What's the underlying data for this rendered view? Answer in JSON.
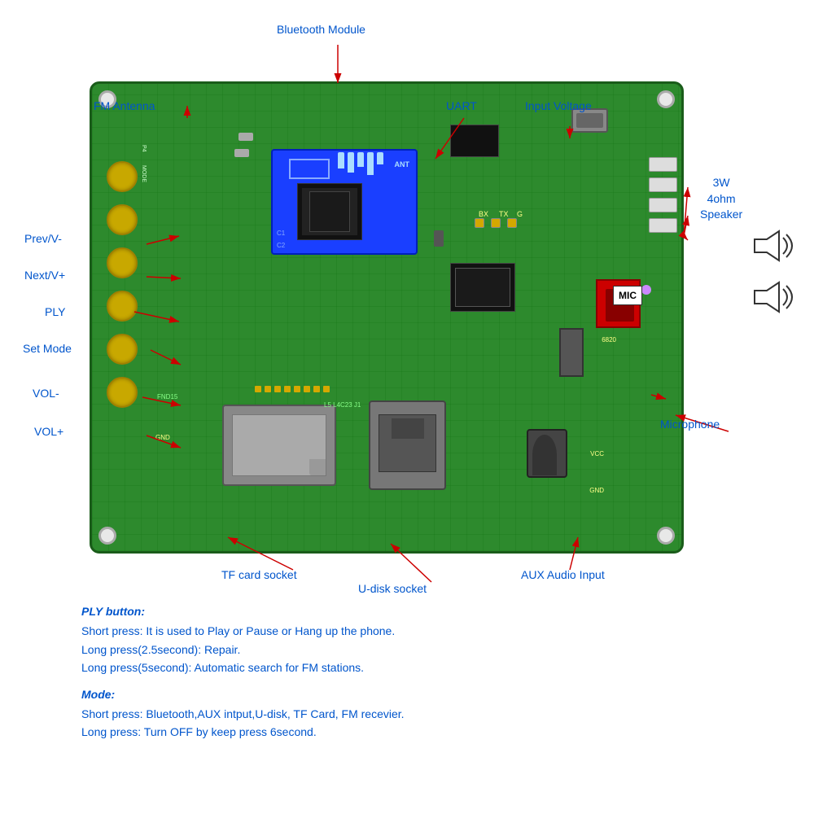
{
  "page": {
    "bg_color": "#ffffff",
    "accent_color": "#0055cc"
  },
  "labels": {
    "bluetooth_module": "Bluetooth Module",
    "fm_antenna": "FM Antenna",
    "uart": "UART",
    "input_voltage": "Input Voltage",
    "speaker": "3W\n4ohm\nSpeaker",
    "speaker_line1": "3W",
    "speaker_line2": "4ohm",
    "speaker_line3": "Speaker",
    "prev_v_minus": "Prev/V-",
    "next_v_plus": "Next/V+",
    "ply": "PLY",
    "set_mode": "Set Mode",
    "vol_minus": "VOL-",
    "vol_plus": "VOL+",
    "tf_card": "TF card socket",
    "u_disk": "U-disk socket",
    "aux_audio": "AUX Audio Input",
    "mic": "MIC",
    "microphone": "Microphone"
  },
  "instructions": {
    "ply_title": "PLY button:",
    "ply_short": "Short press: It is used to Play or Pause or Hang up the phone.",
    "ply_long1": "Long press(2.5second): Repair.",
    "ply_long2": "Long press(5second): Automatic search for FM stations.",
    "mode_title": "Mode:",
    "mode_short": "Short press: Bluetooth,AUX intput,U-disk, TF Card, FM recevier.",
    "mode_long": "Long press: Turn OFF by keep press 6second."
  }
}
